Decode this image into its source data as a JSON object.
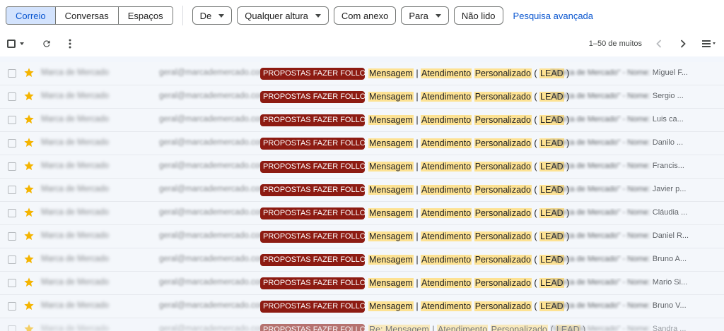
{
  "filters": {
    "segments": [
      {
        "label": "Correio",
        "active": true
      },
      {
        "label": "Conversas",
        "active": false
      },
      {
        "label": "Espaços",
        "active": false
      }
    ],
    "chips": [
      {
        "label": "De",
        "dropdown": true
      },
      {
        "label": "Qualquer altura",
        "dropdown": true
      },
      {
        "label": "Com anexo",
        "dropdown": false
      },
      {
        "label": "Para",
        "dropdown": true
      },
      {
        "label": "Não lido",
        "dropdown": false
      }
    ],
    "advanced_search": "Pesquisa avançada"
  },
  "toolbar": {
    "pagination": "1–50 de muitos",
    "icons": [
      "select-checkbox-icon",
      "refresh-icon",
      "more-vert-icon",
      "chevron-left-icon",
      "chevron-right-icon",
      "density-icon"
    ]
  },
  "colors": {
    "label_bg": "#8d1b12",
    "highlight": "#fde293",
    "star": "#f4b400",
    "accent": "#0b57d0",
    "active_segment": "#d3e3fd"
  },
  "mails": [
    {
      "sender": "Marca de Mercado",
      "email": "geral@marcademercado.com",
      "label": "PROPOSTAS FAZER FOLLOW ...",
      "subject_parts": [
        "Mensagem",
        " | ",
        "Atendimento",
        " ",
        "Personalizado",
        " ( ",
        "LEAD",
        " )"
      ],
      "snippet_prefix": "\"Marca de Mercado\" - Nome: ",
      "snippet_name": "Miguel F...",
      "starred": true
    },
    {
      "sender": "Marca de Mercado",
      "email": "geral@marcademercado.com",
      "label": "PROPOSTAS FAZER FOLLOW ...",
      "subject_parts": [
        "Mensagem",
        " | ",
        "Atendimento",
        " ",
        "Personalizado",
        " ( ",
        "LEAD",
        " )"
      ],
      "snippet_prefix": "\"Marca de Mercado\" - Nome: ",
      "snippet_name": "Sergio ...",
      "starred": true
    },
    {
      "sender": "Marca de Mercado",
      "email": "geral@marcademercado.com",
      "label": "PROPOSTAS FAZER FOLLOW ...",
      "subject_parts": [
        "Mensagem",
        " | ",
        "Atendimento",
        " ",
        "Personalizado",
        " ( ",
        "LEAD",
        " )"
      ],
      "snippet_prefix": "\"Marca de Mercado\" - Nome: ",
      "snippet_name": "Luis ca...",
      "starred": true
    },
    {
      "sender": "Marca de Mercado",
      "email": "geral@marcademercado.com",
      "label": "PROPOSTAS FAZER FOLLOW ...",
      "subject_parts": [
        "Mensagem",
        " | ",
        "Atendimento",
        " ",
        "Personalizado",
        " ( ",
        "LEAD",
        " )"
      ],
      "snippet_prefix": "\"Marca de Mercado\" - Nome: ",
      "snippet_name": "Danilo ...",
      "starred": true
    },
    {
      "sender": "Marca de Mercado",
      "email": "geral@marcademercado.com",
      "label": "PROPOSTAS FAZER FOLLOW ...",
      "subject_parts": [
        "Mensagem",
        " | ",
        "Atendimento",
        " ",
        "Personalizado",
        " ( ",
        "LEAD",
        " )"
      ],
      "snippet_prefix": "\"Marca de Mercado\" - Nome: ",
      "snippet_name": "Francis...",
      "starred": true
    },
    {
      "sender": "Marca de Mercado",
      "email": "geral@marcademercado.com",
      "label": "PROPOSTAS FAZER FOLLOW ...",
      "subject_parts": [
        "Mensagem",
        " | ",
        "Atendimento",
        " ",
        "Personalizado",
        " ( ",
        "LEAD",
        " )"
      ],
      "snippet_prefix": "\"Marca de Mercado\" - Nome: ",
      "snippet_name": "Javier p...",
      "starred": true
    },
    {
      "sender": "Marca de Mercado",
      "email": "geral@marcademercado.com",
      "label": "PROPOSTAS FAZER FOLLOW ...",
      "subject_parts": [
        "Mensagem",
        " | ",
        "Atendimento",
        " ",
        "Personalizado",
        " ( ",
        "LEAD",
        " )"
      ],
      "snippet_prefix": "\"Marca de Mercado\" - Nome: ",
      "snippet_name": "Cláudia ...",
      "starred": true
    },
    {
      "sender": "Marca de Mercado",
      "email": "geral@marcademercado.com",
      "label": "PROPOSTAS FAZER FOLLOW ...",
      "subject_parts": [
        "Mensagem",
        " | ",
        "Atendimento",
        " ",
        "Personalizado",
        " ( ",
        "LEAD",
        " )"
      ],
      "snippet_prefix": "\"Marca de Mercado\" - Nome: ",
      "snippet_name": "Daniel R...",
      "starred": true
    },
    {
      "sender": "Marca de Mercado",
      "email": "geral@marcademercado.com",
      "label": "PROPOSTAS FAZER FOLLOW ...",
      "subject_parts": [
        "Mensagem",
        " | ",
        "Atendimento",
        " ",
        "Personalizado",
        " ( ",
        "LEAD",
        " )"
      ],
      "snippet_prefix": "\"Marca de Mercado\" - Nome: ",
      "snippet_name": "Bruno A...",
      "starred": true
    },
    {
      "sender": "Marca de Mercado",
      "email": "geral@marcademercado.com",
      "label": "PROPOSTAS FAZER FOLLOW ...",
      "subject_parts": [
        "Mensagem",
        " | ",
        "Atendimento",
        " ",
        "Personalizado",
        " ( ",
        "LEAD",
        " )"
      ],
      "snippet_prefix": "\"Marca de Mercado\" - Nome: ",
      "snippet_name": "Mario Si...",
      "starred": true
    },
    {
      "sender": "Marca de Mercado",
      "email": "geral@marcademercado.com",
      "label": "PROPOSTAS FAZER FOLLOW ...",
      "subject_parts": [
        "Mensagem",
        " | ",
        "Atendimento",
        " ",
        "Personalizado",
        " ( ",
        "LEAD",
        " )"
      ],
      "snippet_prefix": "\"Marca de Mercado\" - Nome: ",
      "snippet_name": "Bruno V...",
      "starred": true
    },
    {
      "sender": "Marca de Mercado",
      "email": "geral@marcademercado.com",
      "label": "PROPOSTAS FAZER FOLLOW ...",
      "subject_parts": [
        "Re: Mensagem",
        " | ",
        "Atendimento",
        " ",
        "Personalizado",
        " ( ",
        "LEAD",
        " )"
      ],
      "snippet_prefix": "\"Marca de Mercado\" - Nome: ",
      "snippet_name": "Sandra ...",
      "starred": true
    }
  ]
}
